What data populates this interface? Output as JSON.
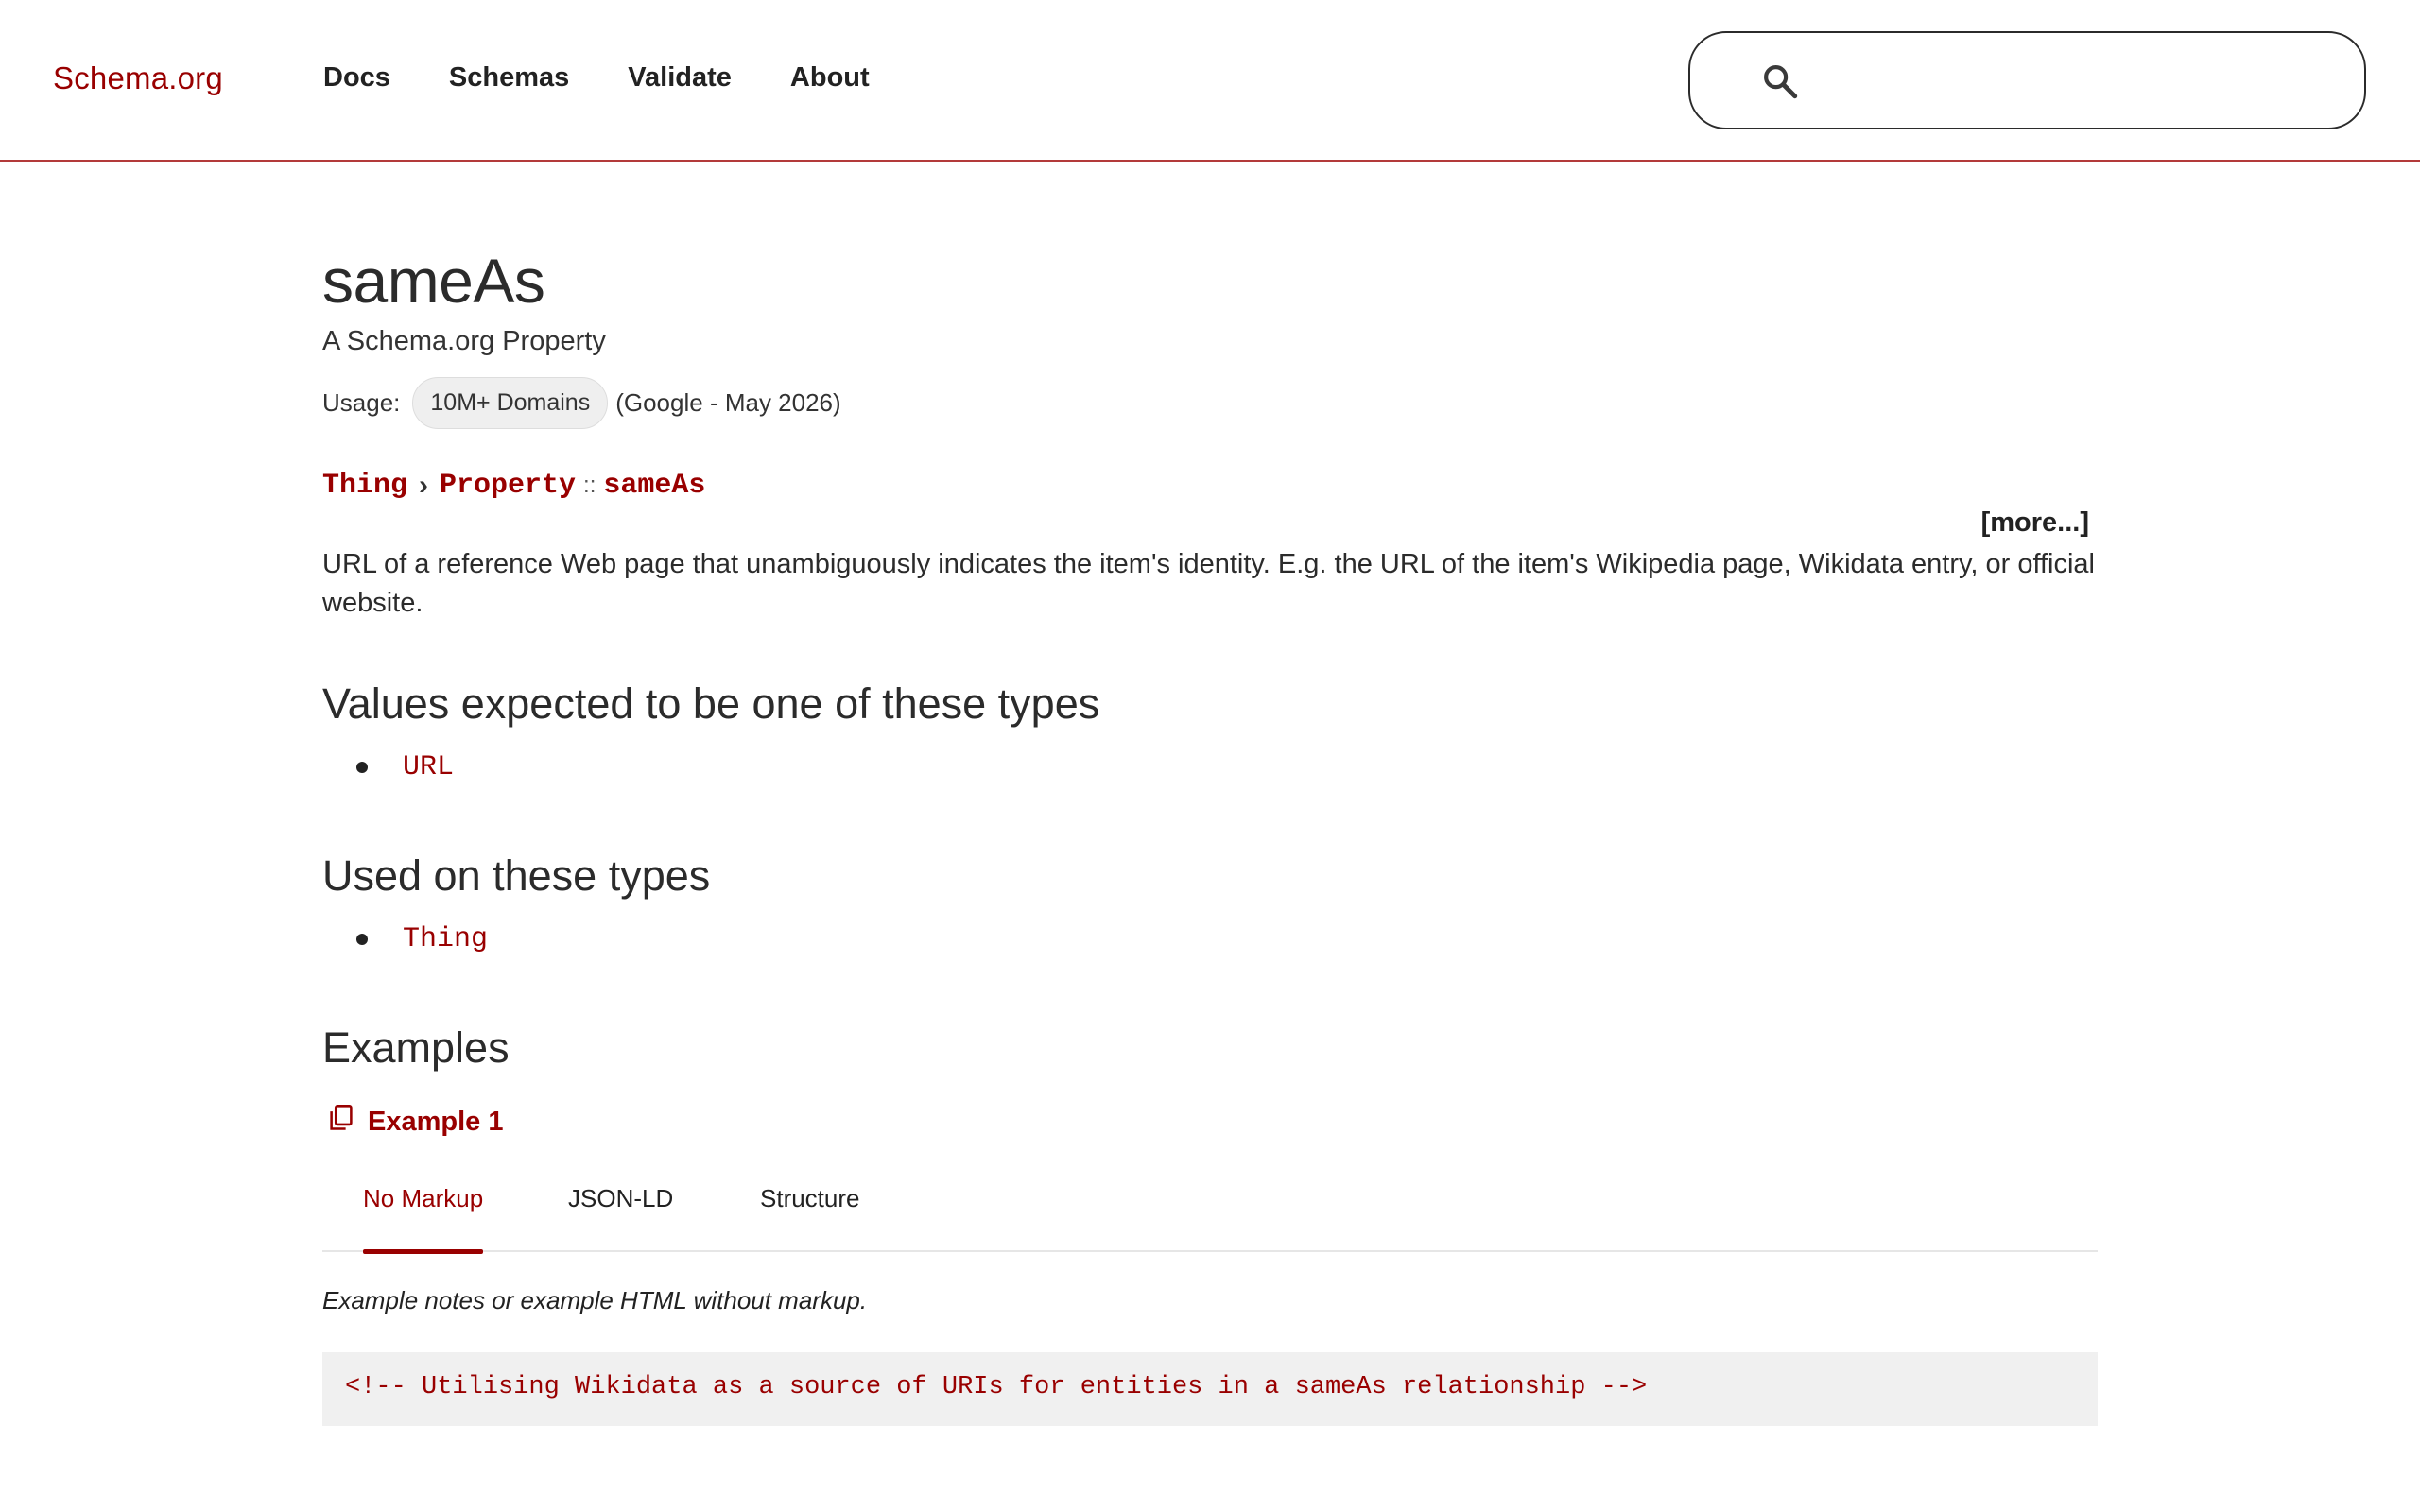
{
  "header": {
    "logo": "Schema.org",
    "nav": [
      {
        "label": "Docs"
      },
      {
        "label": "Schemas"
      },
      {
        "label": "Validate"
      },
      {
        "label": "About"
      }
    ],
    "search": {
      "value": "",
      "placeholder": "",
      "icon": "search-icon"
    }
  },
  "page": {
    "title": "sameAs",
    "subtitle": "A Schema.org Property",
    "usage_label": "Usage:",
    "usage_badge": "10M+ Domains",
    "usage_source": "(Google - May 2026)",
    "breadcrumb": {
      "items": [
        "Thing",
        "Property",
        "sameAs"
      ],
      "separator": "›",
      "property_separator": "::"
    },
    "more_label": "[more...]",
    "description": "URL of a reference Web page that unambiguously indicates the item's identity. E.g. the URL of the item's Wikipedia page, Wikidata entry, or official website."
  },
  "expected_types": {
    "heading": "Values expected to be one of these types",
    "items": [
      "URL"
    ]
  },
  "used_on": {
    "heading": "Used on these types",
    "items": [
      "Thing"
    ]
  },
  "examples": {
    "heading": "Examples",
    "example_link": "Example 1",
    "copy_icon": "copy-icon",
    "tabs": [
      {
        "label": "No Markup",
        "active": true
      },
      {
        "label": "JSON-LD",
        "active": false
      },
      {
        "label": "Structure",
        "active": false
      }
    ],
    "notes": "Example notes or example HTML without markup.",
    "code": "<!-- Utilising Wikidata as a source of URIs for entities in a sameAs relationship -->"
  },
  "colors": {
    "brand": "#990000",
    "header_rule": "#b33a3a",
    "code_bg": "#f0f0f0",
    "badge_bg": "#efefef"
  }
}
